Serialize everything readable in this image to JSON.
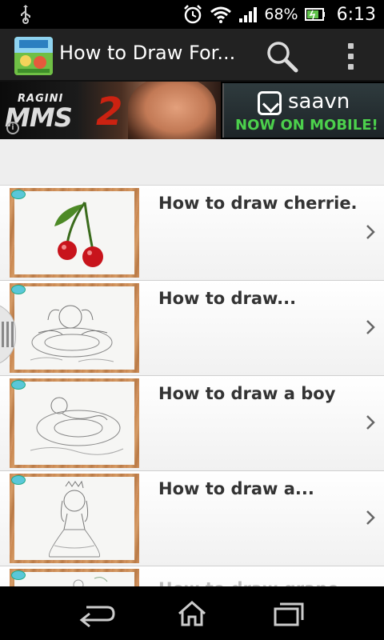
{
  "status_bar": {
    "battery_percent": "68%",
    "time": "6:13",
    "icons": [
      "usb-icon",
      "alarm-icon",
      "wifi-icon",
      "signal-icon",
      "battery-icon"
    ]
  },
  "action_bar": {
    "title": "How to Draw For...",
    "icons": [
      "app-icon",
      "search-icon",
      "overflow-menu-icon"
    ]
  },
  "ad_banner": {
    "left_brand": "RAGINI",
    "left_title": "MMS",
    "left_title_suffix": "2",
    "right_brand": "saavn",
    "right_tagline": "NOW ON MOBILE!"
  },
  "list": {
    "items": [
      {
        "title": "How to draw cherrie...",
        "thumbnail": "cherries"
      },
      {
        "title": "How to draw...",
        "thumbnail": "girl-swimming"
      },
      {
        "title": "How to draw a boy",
        "thumbnail": "boy-floating"
      },
      {
        "title": "How to draw a...",
        "thumbnail": "princess"
      },
      {
        "title": "How to draw grape",
        "thumbnail": "grape"
      }
    ]
  },
  "nav_bar": {
    "icons": [
      "back-icon",
      "home-icon",
      "recent-apps-icon"
    ]
  },
  "colors": {
    "action_bar_bg": "#222222",
    "list_bg": "#eeeeee",
    "title_text": "#333333",
    "saavn_green": "#4cd04c"
  }
}
